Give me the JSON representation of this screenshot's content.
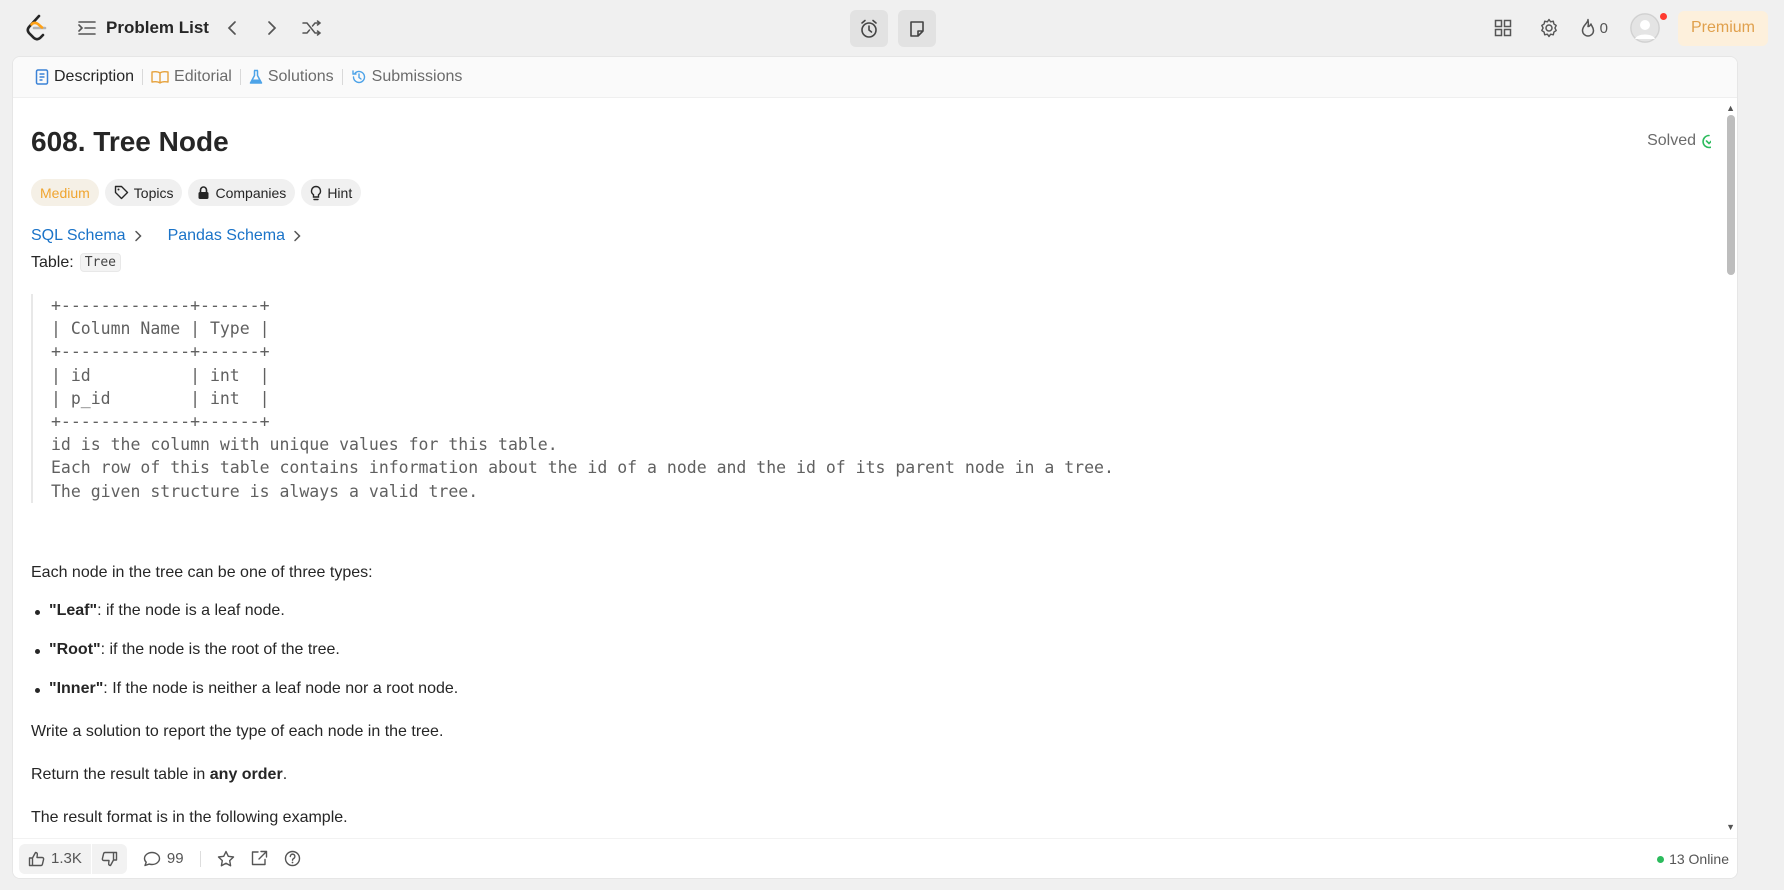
{
  "nav": {
    "problem_list": "Problem List",
    "streak_count": "0",
    "premium": "Premium"
  },
  "tabs": [
    {
      "label": "Description"
    },
    {
      "label": "Editorial"
    },
    {
      "label": "Solutions"
    },
    {
      "label": "Submissions"
    }
  ],
  "problem": {
    "title": "608. Tree Node",
    "status": "Solved",
    "difficulty": "Medium",
    "tags": [
      "Topics",
      "Companies",
      "Hint"
    ],
    "schema_links": [
      "SQL Schema",
      "Pandas Schema"
    ],
    "table_label": "Table:",
    "table_name": "Tree",
    "schema_block": "+-------------+------+\n| Column Name | Type |\n+-------------+------+\n| id          | int  |\n| p_id        | int  |\n+-------------+------+\nid is the column with unique values for this table.\nEach row of this table contains information about the id of a node and the id of its parent node in a tree.\nThe given structure is always a valid tree.",
    "intro": "Each node in the tree can be one of three types:",
    "bullets": [
      {
        "term": "\"Leaf\"",
        "text": ": if the node is a leaf node."
      },
      {
        "term": "\"Root\"",
        "text": ": if the node is the root of the tree."
      },
      {
        "term": "\"Inner\"",
        "text": ": If the node is neither a leaf node nor a root node."
      }
    ],
    "task": "Write a solution to report the type of each node in the tree.",
    "return_prefix": "Return the result table in ",
    "return_bold": "any order",
    "return_suffix": ".",
    "format": "The result format is in the following example."
  },
  "bottom": {
    "likes": "1.3K",
    "comments": "99",
    "online": "13 Online"
  },
  "colors": {
    "medium": "#f0a530",
    "link": "#1a73c8",
    "solved": "#2cbb5d",
    "premium": "#e0a04c"
  }
}
